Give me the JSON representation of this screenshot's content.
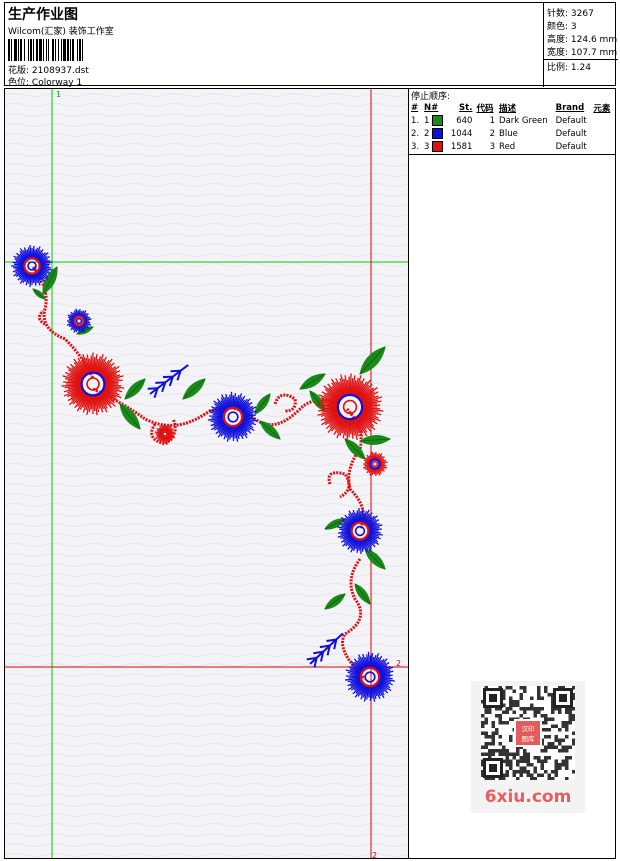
{
  "header": {
    "title": "生产作业图",
    "subtitle": "Wilcom(汇家) 装饰工作室",
    "design_label": "花版:",
    "design_value": "2108937.dst",
    "colorway_label": "色位:",
    "colorway_value": "Colorway 1"
  },
  "stats": {
    "stitches_label": "针数:",
    "stitches": "3267",
    "colors_label": "颜色:",
    "colors": "3",
    "height_label": "高度:",
    "height": "124.6 mm",
    "width_label": "宽度:",
    "width": "107.7 mm",
    "scale_label": "比例:",
    "scale": "1.24"
  },
  "stop_sequence": {
    "title": "停止顺序:",
    "headers": [
      "#",
      "N#",
      "St.",
      "代码",
      "描述",
      "Brand",
      "元素"
    ],
    "rows": [
      {
        "num": "1.",
        "n": "1",
        "color": "#1a8a1a",
        "st": "640",
        "code": "1",
        "desc": "Dark Green",
        "brand": "Default"
      },
      {
        "num": "2.",
        "n": "2",
        "color": "#1010dd",
        "st": "1044",
        "code": "2",
        "desc": "Blue",
        "brand": "Default"
      },
      {
        "num": "3.",
        "n": "3",
        "color": "#e01010",
        "st": "1581",
        "code": "3",
        "desc": "Red",
        "brand": "Default"
      }
    ]
  },
  "canvas": {
    "marker_1": "1",
    "marker_2": "2",
    "marker_2_bottom": "2"
  },
  "colors": {
    "green": "#1a8a1a",
    "blue": "#1010dd",
    "red": "#e01010",
    "guide_green": "#00cc00",
    "guide_red": "#e00000"
  },
  "watermark": {
    "qr_badge": "汉印图库",
    "brand": "6xiu.com"
  }
}
